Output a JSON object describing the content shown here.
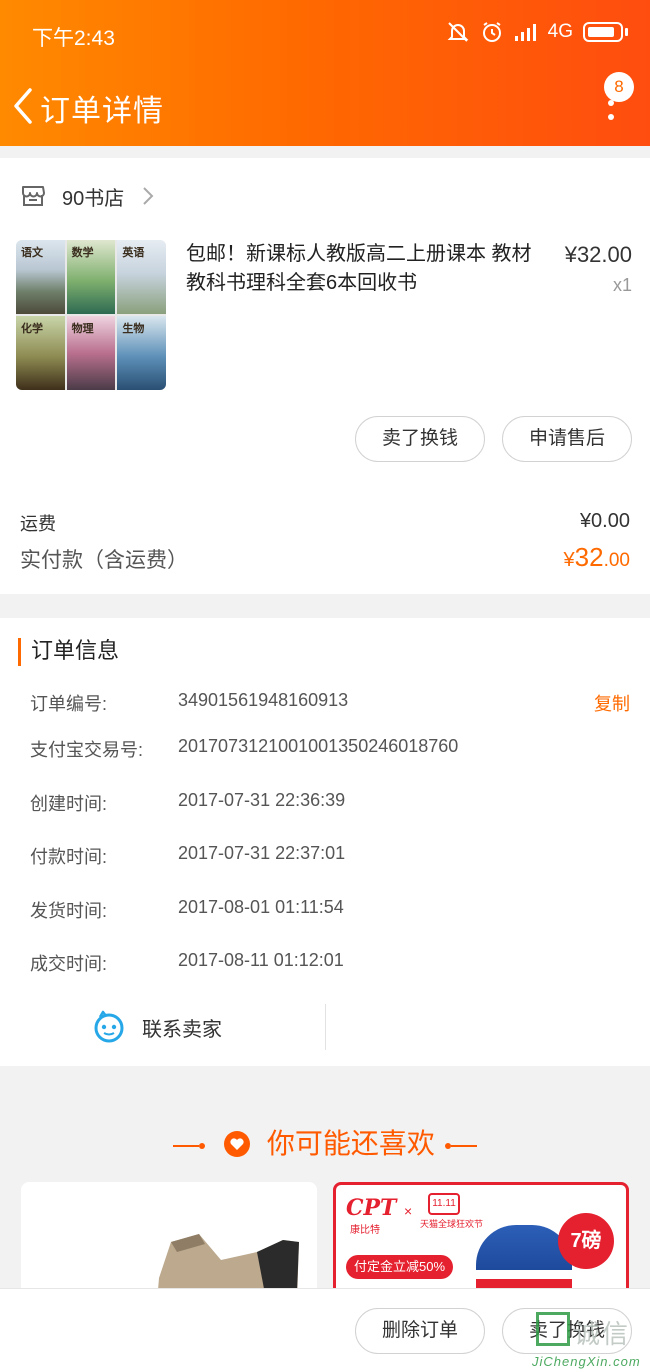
{
  "status_bar": {
    "time": "下午2:43",
    "network": "4G"
  },
  "nav": {
    "title": "订单详情",
    "badge_count": "8"
  },
  "shop": {
    "name": "90书店"
  },
  "product": {
    "title": "包邮！新课标人教版高二上册课本 教材教科书理科全套6本回收书",
    "price": "¥32.00",
    "quantity": "x1",
    "thumbnail_books": [
      "语文",
      "数学",
      "英语",
      "化学",
      "物理",
      "生物"
    ]
  },
  "actions": {
    "sell_label": "卖了换钱",
    "aftersale_label": "申请售后"
  },
  "totals": {
    "shipping_label": "运费",
    "shipping_value": "¥0.00",
    "paid_label": "实付款（含运费）",
    "paid_currency": "¥",
    "paid_integer": "32",
    "paid_decimal": ".00"
  },
  "order_info": {
    "title": "订单信息",
    "copy_label": "复制",
    "rows": [
      {
        "label": "订单编号:",
        "value": "34901561948160913"
      },
      {
        "label": "支付宝交易号:",
        "value": "2017073121001001350246018760"
      },
      {
        "label": "创建时间:",
        "value": "2017-07-31 22:36:39"
      },
      {
        "label": "付款时间:",
        "value": "2017-07-31 22:37:01"
      },
      {
        "label": "发货时间:",
        "value": "2017-08-01 01:11:54"
      },
      {
        "label": "成交时间:",
        "value": "2017-08-11 01:12:01"
      }
    ],
    "contact_label": "联系卖家"
  },
  "recommend": {
    "title": "你可能还喜欢",
    "ad": {
      "brand": "CPT",
      "brand_sub": "康比特",
      "times": "×",
      "event": "11.11",
      "event_sub": "天猫全球狂欢节",
      "promo": "付定金立减50%",
      "badge": "7磅"
    }
  },
  "bottom_bar": {
    "delete_label": "删除订单",
    "sell_label": "卖了换钱"
  },
  "watermark": {
    "text": "诚信",
    "url": "JiChengXin.com"
  },
  "colors": {
    "accent": "#ff6a00",
    "header_start": "#ff8a00",
    "header_end": "#ff4d0f",
    "ad_red": "#e5202f"
  }
}
